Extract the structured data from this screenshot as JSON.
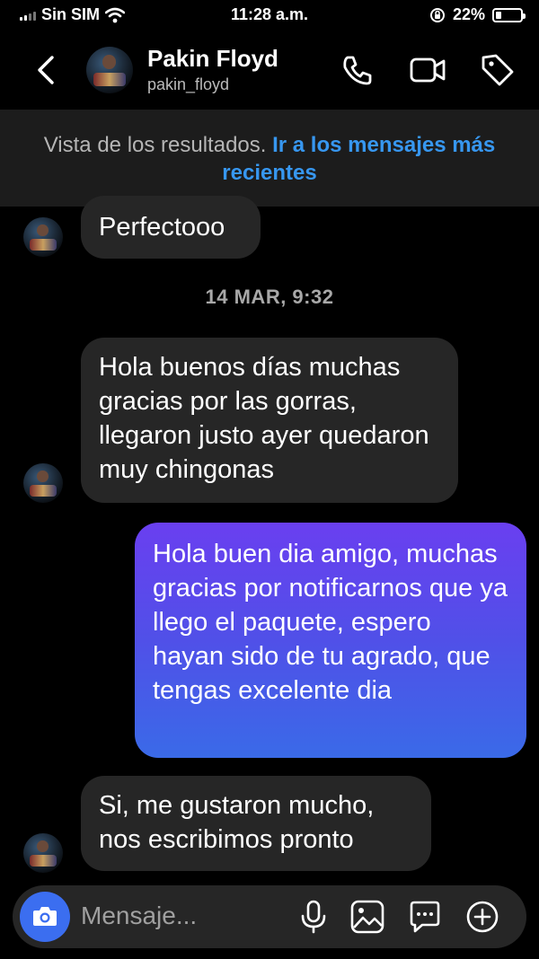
{
  "status_bar": {
    "carrier": "Sin SIM",
    "time": "11:28 a.m.",
    "battery": "22%",
    "battery_level": 0.22
  },
  "header": {
    "name": "Pakin Floyd",
    "username": "pakin_floyd",
    "icons": [
      "back-chevron-icon",
      "phone-icon",
      "video-camera-icon",
      "tag-icon"
    ]
  },
  "banner": {
    "text": "Vista de los resultados.",
    "link": "Ir a los mensajes más recientes"
  },
  "messages": {
    "m1": "Perfectooo",
    "timestamp": "14 MAR, 9:32",
    "m2": "Hola buenos días muchas gracias por las gorras, llegaron justo ayer quedaron muy chingonas",
    "m3": "Hola buen dia amigo, muchas gracias por notificarnos que ya llego el paquete, espero hayan sido de tu agrado, que tengas excelente dia",
    "m4": "Si, me gustaron mucho, nos escribimos pronto"
  },
  "composer": {
    "placeholder": "Mensaje...",
    "icons": [
      "camera-icon",
      "microphone-icon",
      "image-icon",
      "sticker-icon",
      "plus-circle-icon"
    ]
  },
  "colors": {
    "background": "#000000",
    "incoming_bubble": "#262626",
    "outgoing_gradient_top": "#6a3ff0",
    "outgoing_gradient_bottom": "#3a6ae8",
    "link": "#3797f0",
    "camera_button": "#3b6ef0"
  }
}
